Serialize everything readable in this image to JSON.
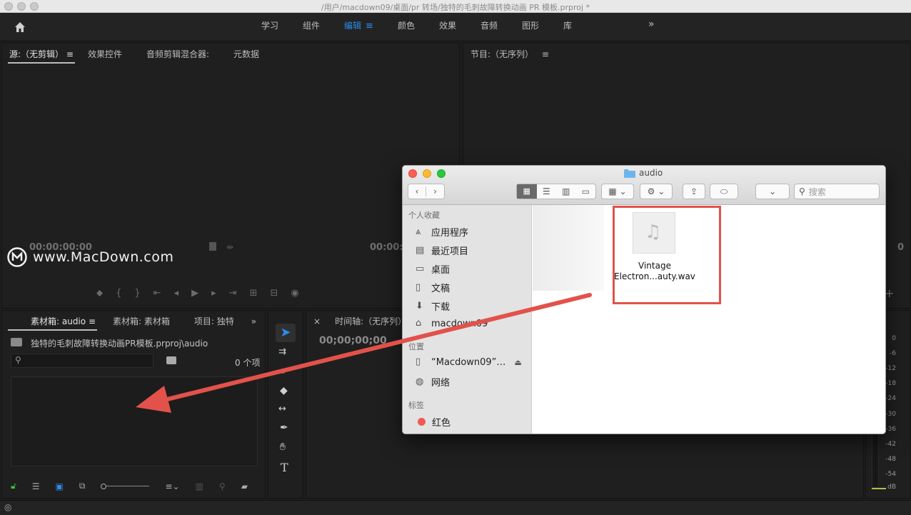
{
  "window_title": "/用户/macdown09/桌面/pr 转场/独特的毛刺故障转换动画 PR 模板.prproj *",
  "workspace": {
    "tabs": [
      "学习",
      "组件",
      "编辑",
      "颜色",
      "效果",
      "音频",
      "图形",
      "库"
    ],
    "active_tab": "编辑",
    "more_label": "»"
  },
  "source_panel": {
    "tabs": [
      "源:（无剪辑）",
      "效果控件",
      "音频剪辑混合器:",
      "元数据"
    ],
    "timecode_in": "00:00:00:00",
    "timecode_out": "00:00:0"
  },
  "program_panel": {
    "tab": "节目:（无序列）",
    "timecode": "0"
  },
  "watermark": {
    "text": "www.MacDown.com"
  },
  "project_panel": {
    "tabs": [
      "素材箱: audio",
      "素材箱: 素材箱",
      "项目: 独特"
    ],
    "path": "独特的毛刺故障转换动画PR模板.prproj\\audio",
    "search_placeholder": "",
    "item_count": "0 个项"
  },
  "timeline_panel": {
    "tab": "时间轴:（无序列）",
    "timecode": "00;00;00;00"
  },
  "meter": {
    "scale": [
      "0",
      "-6",
      "-12",
      "-18",
      "-24",
      "-30",
      "-36",
      "-42",
      "-48",
      "-54",
      "dB"
    ]
  },
  "finder": {
    "title": "audio",
    "search_placeholder": "搜索",
    "sidebar": {
      "favorites_header": "个人收藏",
      "favorites": [
        "应用程序",
        "最近项目",
        "桌面",
        "文稿",
        "下载",
        "macdown09"
      ],
      "locations_header": "位置",
      "locations": [
        "“Macdown09”…",
        "网络"
      ],
      "tags_header": "标签",
      "tags": [
        "红色"
      ]
    },
    "file": {
      "name_line1": "Vintage",
      "name_line2": "Electron...auty.wav"
    }
  },
  "colors": {
    "accent_blue": "#2d8ceb",
    "annotation_red": "#e2524b",
    "tag_red": "#ef5b52"
  }
}
